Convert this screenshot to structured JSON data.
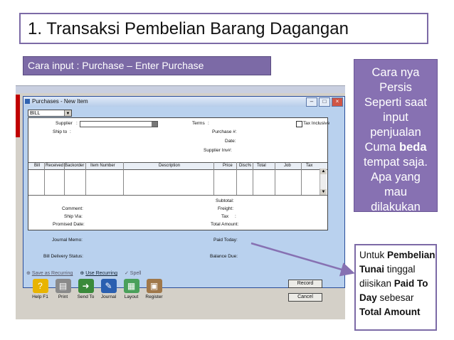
{
  "slide": {
    "title": "1. Transaksi Pembelian Barang Dagangan",
    "how_to": "Cara input : Purchase – Enter Purchase",
    "note_top": [
      "Cara nya",
      "Persis",
      "Seperti saat",
      "input",
      "penjualan",
      "Cuma ",
      "beda",
      "tempat saja.",
      "Apa yang",
      "mau",
      "dilakukan"
    ],
    "note_bottom": {
      "p1": "Untuk ",
      "p2": "Pembelian Tunai",
      "p3": " tinggal diisikan ",
      "p4": "Paid To Day",
      "p5": " sebesar ",
      "p6": "Total Amount"
    }
  },
  "window": {
    "title": "Purchases - New Item",
    "type_select": "BILL",
    "labels": {
      "supplier": "Supplier",
      "colon": ":",
      "terms": "Terms",
      "tax_inclusive": "Tax Inclusive",
      "ship_to": "Ship to",
      "purchase_no": "Purchase #:",
      "date": "Date:",
      "supplier_inv": "Supplier Inv#:",
      "subtotal": "Subtotal:",
      "freight": "Freight:",
      "tax": "Tax",
      "total_amount": "Total Amount:",
      "comment": "Comment:",
      "ship_via": "Ship Via:",
      "promised_date": "Promised Date:",
      "journal_memo": "Journal Memo:",
      "paid_today": "Paid Today:",
      "bill_delivery": "Bill Delivery Status:",
      "balance_due": "Balance Due:"
    },
    "columns": [
      "Bill",
      "Received",
      "Backorder",
      "Item Number",
      "Description",
      "Price",
      "Disc%",
      "Total",
      "Job",
      "Tax"
    ],
    "links": {
      "save_recurring": "Save as Recurring",
      "use_recurring": "Use Recurring",
      "spell": "Spell"
    },
    "toolbar": [
      "Help F1",
      "Print",
      "Send To",
      "Journal",
      "Layout",
      "Register"
    ],
    "buttons": {
      "record": "Record",
      "cancel": "Cancel"
    }
  },
  "colors": {
    "accent": "#7c6aa6",
    "note": "#8771b2",
    "window_bg": "#b9d1ee"
  }
}
